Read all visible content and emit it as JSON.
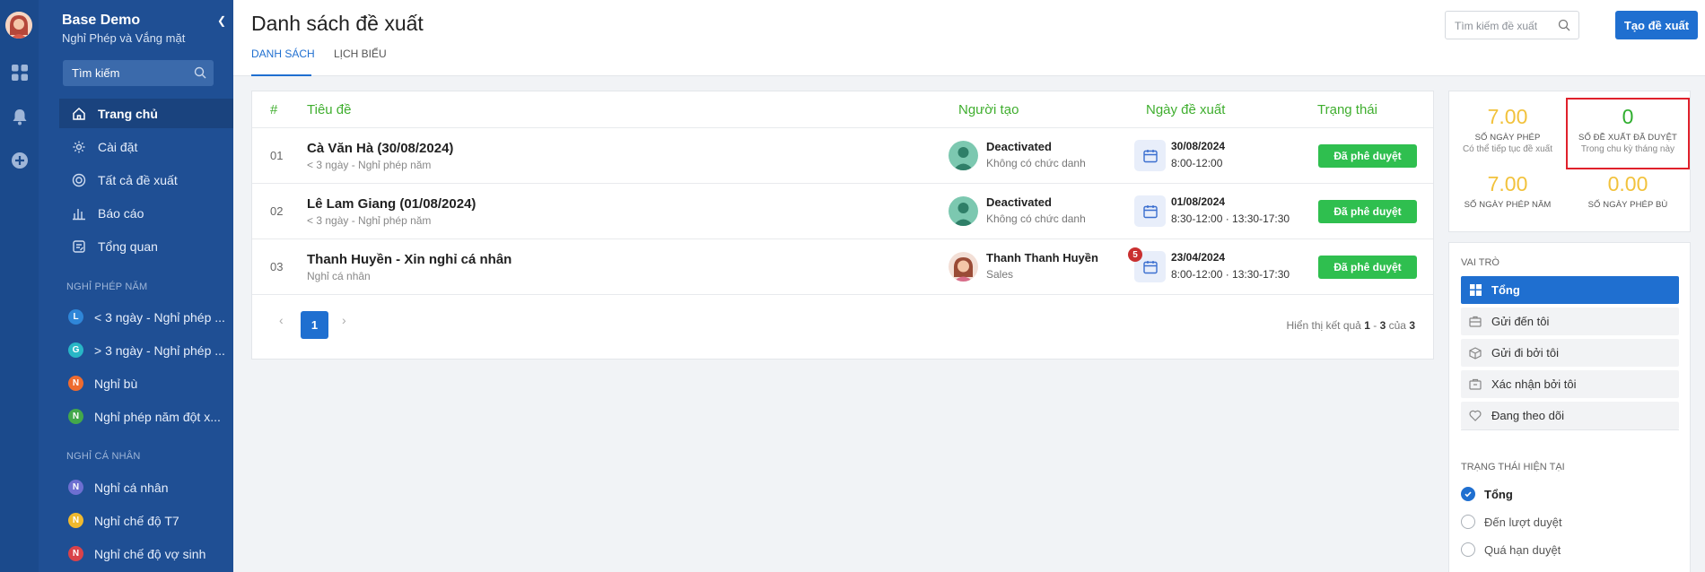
{
  "app": {
    "title": "Base Demo",
    "subtitle": "Nghỉ Phép và Vắng mặt",
    "search_placeholder": "Tìm kiếm"
  },
  "nav": [
    {
      "label": "Trang chủ",
      "icon": "home-icon",
      "active": true
    },
    {
      "label": "Cài đặt",
      "icon": "gear-icon"
    },
    {
      "label": "Tất cả đề xuất",
      "icon": "circle-target-icon"
    },
    {
      "label": "Báo cáo",
      "icon": "bar-chart-icon"
    },
    {
      "label": "Tổng quan",
      "icon": "overview-icon"
    }
  ],
  "groups": {
    "g1": {
      "title": "NGHỈ PHÉP NĂM",
      "items": [
        {
          "letter": "L",
          "color": "#2f86d8",
          "label": "< 3 ngày - Nghỉ phép ..."
        },
        {
          "letter": "G",
          "color": "#28b6c6",
          "label": "> 3 ngày - Nghỉ phép ..."
        },
        {
          "letter": "N",
          "color": "#ee6b2f",
          "label": "Nghỉ bù"
        },
        {
          "letter": "N",
          "color": "#43a84a",
          "label": "Nghỉ phép năm đột x..."
        }
      ]
    },
    "g2": {
      "title": "NGHỈ CÁ NHÂN",
      "items": [
        {
          "letter": "N",
          "color": "#6d6fd1",
          "label": "Nghỉ cá nhân"
        },
        {
          "letter": "N",
          "color": "#f0b92e",
          "label": "Nghỉ chế độ T7"
        },
        {
          "letter": "N",
          "color": "#d9424a",
          "label": "Nghỉ chế độ vợ sinh"
        }
      ]
    }
  },
  "header": {
    "title": "Danh sách đề xuất",
    "tabs": [
      "DANH SÁCH",
      "LỊCH BIỂU"
    ],
    "search_placeholder": "Tìm kiếm đề xuất",
    "create_label": "Tạo đề xuất"
  },
  "table": {
    "columns": {
      "no": "#",
      "title": "Tiêu đề",
      "creator": "Người tạo",
      "date": "Ngày đề xuất",
      "status": "Trạng thái"
    },
    "rows": [
      {
        "no": "01",
        "title": "Cà Văn Hà (30/08/2024)",
        "sub": "< 3 ngày - Nghỉ phép năm",
        "creator": "Deactivated",
        "role": "Không có chức danh",
        "date": "30/08/2024",
        "time": "8:00-12:00",
        "badge": "",
        "status": "Đã phê duyệt"
      },
      {
        "no": "02",
        "title": "Lê Lam Giang (01/08/2024)",
        "sub": "< 3 ngày - Nghỉ phép năm",
        "creator": "Deactivated",
        "role": "Không có chức danh",
        "date": "01/08/2024",
        "time": "8:30-12:00 · 13:30-17:30",
        "badge": "",
        "status": "Đã phê duyệt"
      },
      {
        "no": "03",
        "title": "Thanh Huyền - Xin nghỉ cá nhân",
        "sub": "Nghỉ cá nhân",
        "creator": "Thanh Thanh Huyền",
        "role": "Sales",
        "date": "23/04/2024",
        "time": "8:00-12:00 · 13:30-17:30",
        "badge": "5",
        "status": "Đã phê duyệt"
      }
    ]
  },
  "pagination": {
    "prev": "‹",
    "page": "1",
    "next": "›",
    "text": "Hiển thị kết quả",
    "from": "1",
    "dash": "-",
    "to": "3",
    "of": "của",
    "total": "3"
  },
  "stats": [
    {
      "value": "7.00",
      "label": "SỐ NGÀY PHÉP",
      "sub": "Có thể tiếp tục đề xuất"
    },
    {
      "value": "0",
      "label": "SỐ ĐỀ XUẤT ĐÃ DUYỆT",
      "sub": "Trong chu kỳ tháng này"
    },
    {
      "value": "7.00",
      "label": "SỐ NGÀY PHÉP NĂM",
      "sub": ""
    },
    {
      "value": "0.00",
      "label": "SỐ NGÀY PHÉP BÙ",
      "sub": ""
    }
  ],
  "roles": {
    "title": "VAI TRÒ",
    "items": [
      {
        "label": "Tổng",
        "icon": "grid-icon",
        "active": true
      },
      {
        "label": "Gửi đến tôi",
        "icon": "briefcase-icon"
      },
      {
        "label": "Gửi đi bởi tôi",
        "icon": "box-icon"
      },
      {
        "label": "Xác nhận bởi tôi",
        "icon": "bag-icon"
      },
      {
        "label": "Đang theo dõi",
        "icon": "heart-icon"
      }
    ]
  },
  "status_filter": {
    "title": "TRẠNG THÁI HIỆN TẠI",
    "items": [
      {
        "label": "Tổng",
        "checked": true
      },
      {
        "label": "Đến lượt duyệt"
      },
      {
        "label": "Quá hạn duyệt"
      }
    ]
  },
  "colors": {
    "sidebar": "#1f4f94",
    "accent": "#1f6fd0",
    "approved": "#2fbf4f",
    "header_green": "#3fae2e",
    "stat_yellow": "#f2c23c",
    "highlight": "#e0212b"
  }
}
